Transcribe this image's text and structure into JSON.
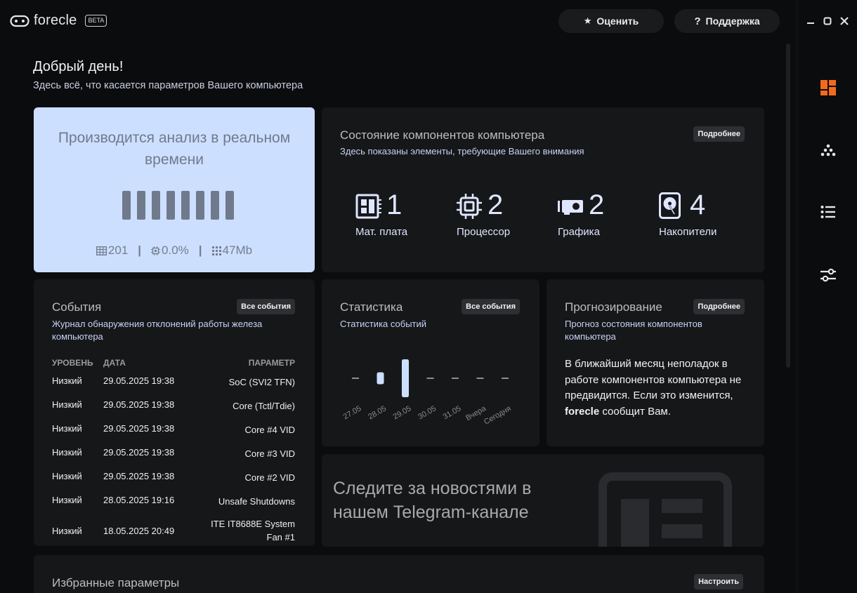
{
  "app": {
    "name": "forecle",
    "badge": "BETA"
  },
  "topbar": {
    "rate_label": "Оценить",
    "support_label": "Поддержка"
  },
  "greeting": {
    "title": "Добрый день!",
    "subtitle": "Здесь всё, что касается параметров Вашего компьютера"
  },
  "analysis": {
    "title": "Производится анализ в реальном времени",
    "stats": {
      "count": "201",
      "cpu": "0.0%",
      "mem": "47Mb"
    }
  },
  "components": {
    "title": "Состояние компонентов компьютера",
    "subtitle": "Здесь показаны элементы, требующие Вашего внимания",
    "more_label": "Подробнее",
    "items": [
      {
        "icon": "motherboard-icon",
        "count": "1",
        "label": "Мат. плата"
      },
      {
        "icon": "cpu-icon",
        "count": "2",
        "label": "Процессор"
      },
      {
        "icon": "gpu-icon",
        "count": "2",
        "label": "Графика"
      },
      {
        "icon": "drive-icon",
        "count": "4",
        "label": "Накопители"
      }
    ]
  },
  "events": {
    "title": "События",
    "subtitle": "Журнал обнаружения отклонений работы железа компьютера",
    "all_label": "Все события",
    "columns": {
      "level": "УРОВЕНЬ",
      "date": "ДАТА",
      "param": "ПАРАМЕТР"
    },
    "rows": [
      {
        "level": "Низкий",
        "date": "29.05.2025 19:38",
        "param": "SoC (SVI2 TFN)"
      },
      {
        "level": "Низкий",
        "date": "29.05.2025 19:38",
        "param": "Core (Tctl/Tdie)"
      },
      {
        "level": "Низкий",
        "date": "29.05.2025 19:38",
        "param": "Core #4 VID"
      },
      {
        "level": "Низкий",
        "date": "29.05.2025 19:38",
        "param": "Core #3 VID"
      },
      {
        "level": "Низкий",
        "date": "29.05.2025 19:38",
        "param": "Core #2 VID"
      },
      {
        "level": "Низкий",
        "date": "28.05.2025 19:16",
        "param": "Unsafe Shutdowns"
      },
      {
        "level": "Низкий",
        "date": "18.05.2025 20:49",
        "param": "ITE IT8688E System Fan #1"
      }
    ]
  },
  "statistics": {
    "title": "Статистика",
    "subtitle": "Статистика событий",
    "all_label": "Все события"
  },
  "chart_data": {
    "type": "bar",
    "categories": [
      "27.05",
      "28.05",
      "29.05",
      "30.05",
      "31.05",
      "Вчера",
      "Сегодня"
    ],
    "values": [
      0,
      1,
      5,
      0,
      0,
      0,
      0
    ],
    "ylim": [
      0,
      5
    ]
  },
  "forecast": {
    "title": "Прогнозирование",
    "subtitle": "Прогноз состояния компонентов компьютера",
    "more_label": "Подробнее",
    "text_before": "В ближайший месяц неполадок в работе компонентов компьютера не предвидится. Если это изменится, ",
    "brand": "forecle",
    "text_after": " сообщит Вам."
  },
  "telegram": {
    "text": "Следите за новостями в нашем Telegram-канале"
  },
  "favorites": {
    "title": "Избранные параметры",
    "configure_label": "Настроить"
  },
  "colors": {
    "accent": "#f26b1d",
    "analysis_bg": "#cddfff",
    "card_bg": "#161719"
  }
}
